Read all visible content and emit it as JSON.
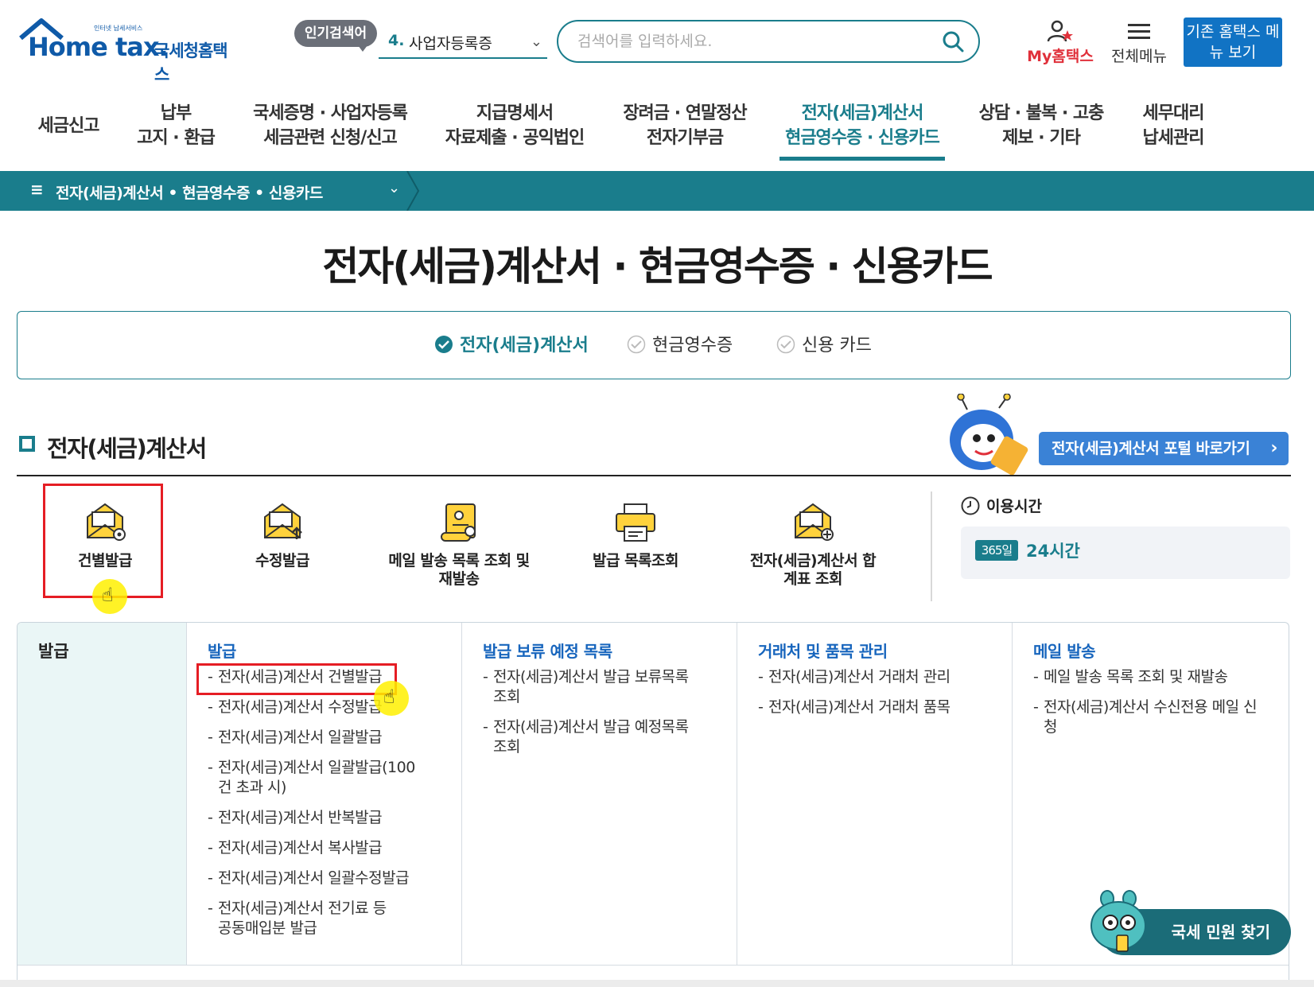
{
  "header": {
    "logo_text": "Home tax.",
    "logo_sub": "국세청홈택스",
    "logo_tiny": "인터넷 납세서비스",
    "popular_badge": "인기검색어",
    "popular_num": "4.",
    "popular_text": "사업자등록증",
    "search_placeholder": "검색어를 입력하세요.",
    "my_hometax": "My홈택스",
    "all_menu": "전체메뉴",
    "old_menu": "기존 홈택스 메뉴 보기"
  },
  "mainnav": {
    "items": [
      {
        "label1": "세금신고",
        "label2": ""
      },
      {
        "label1": "납부",
        "label2": "고지 · 환급"
      },
      {
        "label1": "국세증명 · 사업자등록",
        "label2": "세금관련 신청/신고"
      },
      {
        "label1": "지급명세서",
        "label2": "자료제출 · 공익법인"
      },
      {
        "label1": "장려금 · 연말정산",
        "label2": "전자기부금"
      },
      {
        "label1": "전자(세금)계산서",
        "label2": "현금영수증 · 신용카드"
      },
      {
        "label1": "상담 · 불복 · 고충",
        "label2": "제보 · 기타"
      },
      {
        "label1": "세무대리",
        "label2": "납세관리"
      }
    ]
  },
  "breadcrumb": {
    "hamburger": "≡",
    "text": "전자(세금)계산서 • 현금영수증 • 신용카드"
  },
  "page_title": "전자(세금)계산서 · 현금영수증 · 신용카드",
  "tabs": [
    {
      "label": "전자(세금)계산서",
      "active": true
    },
    {
      "label": "현금영수증",
      "active": false
    },
    {
      "label": "신용 카드",
      "active": false
    }
  ],
  "section": {
    "title": "전자(세금)계산서",
    "portal_button": "전자(세금)계산서 포털 바로가기"
  },
  "quick_icons": [
    {
      "label": "건별발급",
      "icon": "envelope-gear-icon"
    },
    {
      "label": "수정발급",
      "icon": "envelope-up-icon"
    },
    {
      "label": "메일 발송 목록 조회 및 재발송",
      "icon": "scroll-doc-icon"
    },
    {
      "label": "발급 목록조회",
      "icon": "printer-icon"
    },
    {
      "label": "전자(세금)계산서 합계표 조회",
      "icon": "envelope-plus-icon"
    }
  ],
  "usage": {
    "title": "이용시간",
    "badge": "365일",
    "value": "24시간"
  },
  "menu": {
    "category": "발급",
    "columns": [
      {
        "title": "발급",
        "items": [
          "전자(세금)계산서 건별발급",
          "전자(세금)계산서 수정발급",
          "전자(세금)계산서 일괄발급",
          "전자(세금)계산서 일괄발급(100건 초과 시)",
          "전자(세금)계산서 반복발급",
          "전자(세금)계산서 복사발급",
          "전자(세금)계산서 일괄수정발급",
          "전자(세금)계산서 전기료 등 공동매입분 발급"
        ]
      },
      {
        "title": "발급 보류 예정 목록",
        "items": [
          "전자(세금)계산서 발급 보류목록 조회",
          "전자(세금)계산서 발급 예정목록 조회"
        ]
      },
      {
        "title": "거래처 및 품목 관리",
        "items": [
          "전자(세금)계산서 거래처 관리",
          "전자(세금)계산서 거래처 품목"
        ]
      },
      {
        "title": "메일 발송",
        "items": [
          "메일 발송 목록 조회 및 재발송",
          "전자(세금)계산서 수신전용 메일 신청"
        ]
      }
    ]
  },
  "civil_button": "국세 민원 찾기",
  "colors": {
    "teal": "#1a7d8c",
    "blue": "#1173c4",
    "link_blue": "#1765bd",
    "highlight_red": "#e51d24"
  }
}
